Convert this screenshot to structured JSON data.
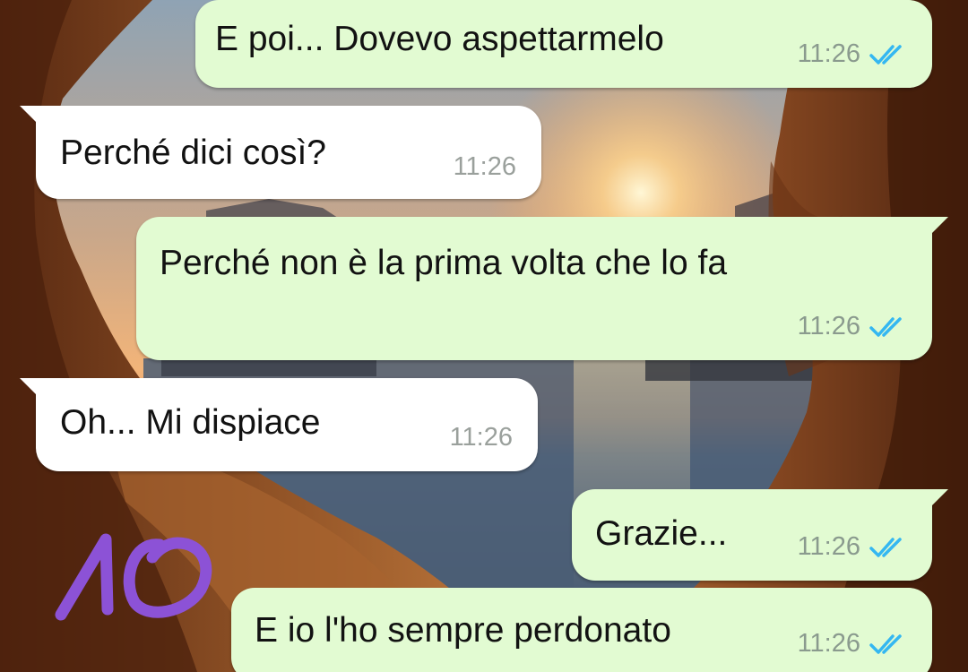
{
  "chat": {
    "wallpaper": "sunset-cave-sea",
    "read_tick_color": "#34b7f1",
    "outgoing_bubble_color": "#e2fbd2",
    "incoming_bubble_color": "#ffffff",
    "messages": [
      {
        "direction": "outgoing",
        "text": "E poi... Dovevo aspettarmelo",
        "time": "11:26",
        "status": "read"
      },
      {
        "direction": "incoming",
        "text": "Perché dici così?",
        "time": "11:26"
      },
      {
        "direction": "outgoing",
        "text": "Perché non è la prima volta che lo fa",
        "time": "11:26",
        "status": "read"
      },
      {
        "direction": "incoming",
        "text": "Oh... Mi dispiace",
        "time": "11:26"
      },
      {
        "direction": "outgoing",
        "text": "Grazie...",
        "time": "11:26",
        "status": "read"
      },
      {
        "direction": "outgoing",
        "text": "E io l'ho sempre perdonato",
        "time": "11:26",
        "status": "read"
      }
    ]
  },
  "annotation": {
    "text": "10",
    "color": "#8c52d6"
  }
}
